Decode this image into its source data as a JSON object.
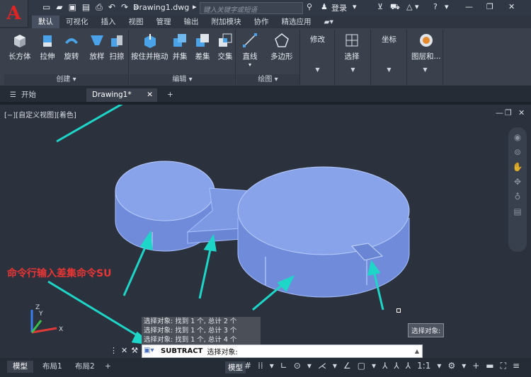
{
  "titlebar": {
    "logo": "A",
    "doc_title": "Drawing1.dwg",
    "search_placeholder": "键入关键字或短语",
    "login": "登录"
  },
  "ribbon_tabs": [
    "默认",
    "可视化",
    "插入",
    "视图",
    "管理",
    "输出",
    "附加模块",
    "协作",
    "精选应用"
  ],
  "panels": {
    "create": {
      "title": "创建",
      "tools": [
        "长方体",
        "拉伸",
        "旋转",
        "放样",
        "扫掠"
      ]
    },
    "edit": {
      "title": "编辑",
      "tools": [
        "按住并拖动",
        "并集",
        "差集",
        "交集"
      ]
    },
    "draw": {
      "title": "绘图",
      "tools": [
        "直线",
        "多边形"
      ]
    },
    "modify": {
      "title": "修改"
    },
    "select": {
      "title": "选择"
    },
    "coords": {
      "title": "坐标"
    },
    "layers": {
      "title": "图层和..."
    }
  },
  "doc_tabs": {
    "start": "开始",
    "drawing": "Drawing1*"
  },
  "viewport": {
    "label": "[−][自定义视图][着色]",
    "annotation": "命令行输入差集命令SU",
    "tooltip": "选择对象:",
    "history": [
      "选择对象: 找到 1 个, 总计 2 个",
      "选择对象: 找到 1 个, 总计 3 个",
      "选择对象: 找到 1 个, 总计 4 个"
    ]
  },
  "command": {
    "name": "SUBTRACT",
    "prompt": "选择对象:"
  },
  "layout_tabs": [
    "模型",
    "布局1",
    "布局2"
  ],
  "status": {
    "model": "模型",
    "scale": "1:1"
  },
  "colors": {
    "accent": "#1ed6c8",
    "solid": "#7b96e0",
    "annotation": "#e83535"
  }
}
